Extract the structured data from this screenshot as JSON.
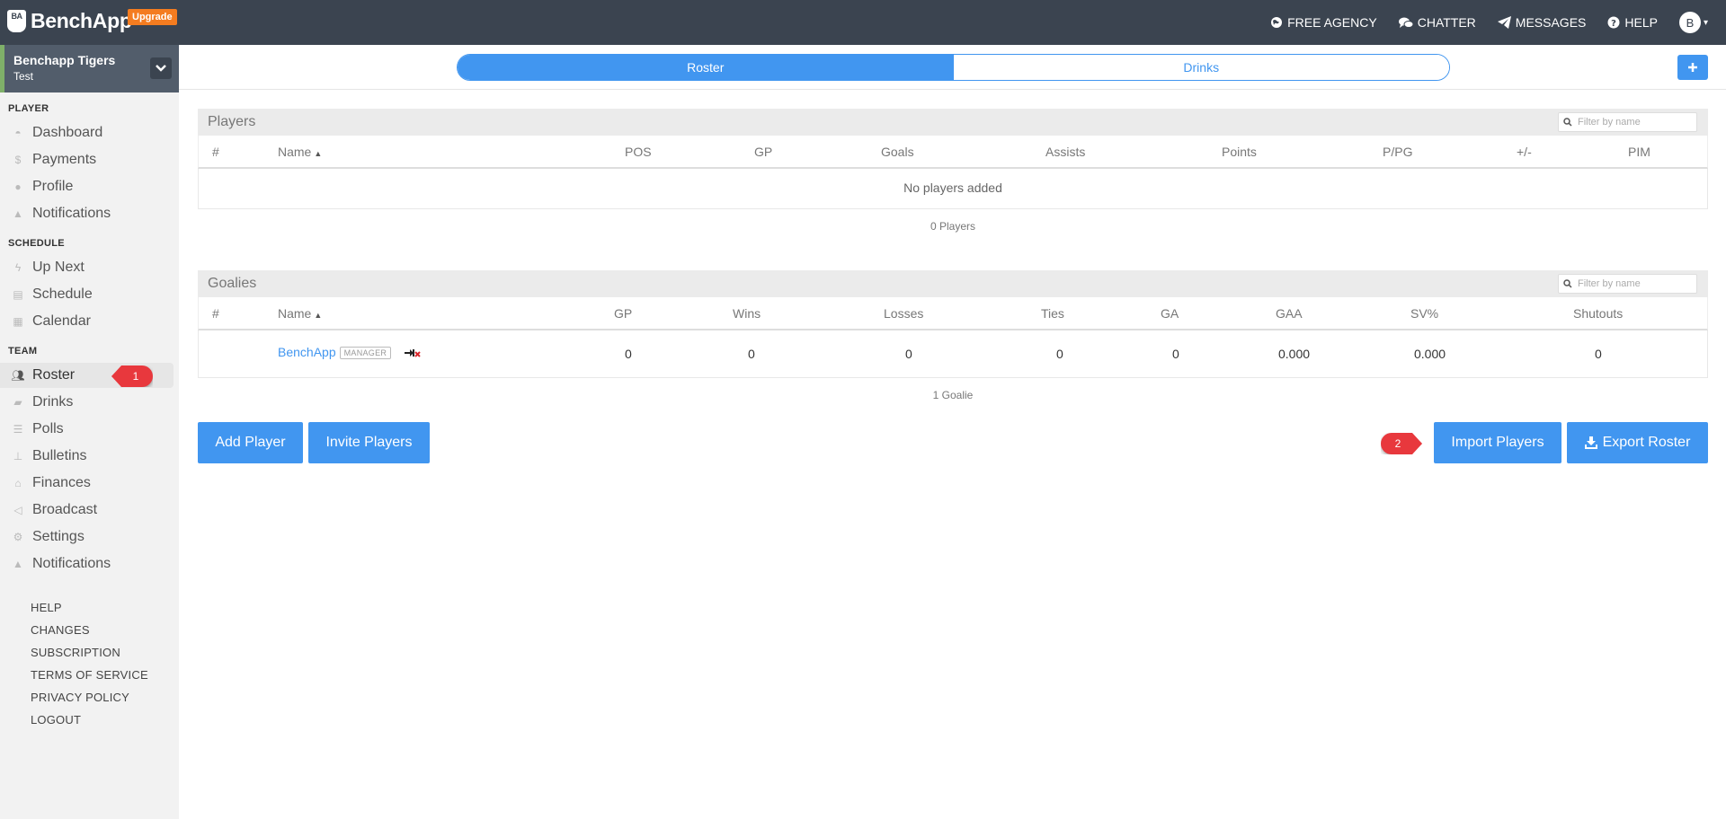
{
  "header": {
    "logo_mark": "BA",
    "logo_text": "BenchApp",
    "upgrade_label": "Upgrade",
    "nav": {
      "free_agency": "FREE AGENCY",
      "chatter": "CHATTER",
      "messages": "MESSAGES",
      "help": "HELP"
    },
    "avatar_initial": "B"
  },
  "sidebar": {
    "team_name": "Benchapp Tigers",
    "team_sub": "Test",
    "sections": {
      "player": "PLAYER",
      "schedule": "SCHEDULE",
      "team": "TEAM"
    },
    "player_items": [
      "Dashboard",
      "Payments",
      "Profile",
      "Notifications"
    ],
    "schedule_items": [
      "Up Next",
      "Schedule",
      "Calendar"
    ],
    "team_items": [
      "Roster",
      "Drinks",
      "Polls",
      "Bulletins",
      "Finances",
      "Broadcast",
      "Settings",
      "Notifications"
    ],
    "footer_links": [
      "HELP",
      "CHANGES",
      "SUBSCRIPTION",
      "TERMS OF SERVICE",
      "PRIVACY POLICY",
      "LOGOUT"
    ]
  },
  "markers": {
    "one": "1",
    "two": "2"
  },
  "tabs": {
    "roster": "Roster",
    "drinks": "Drinks"
  },
  "players": {
    "title": "Players",
    "filter_placeholder": "Filter by name",
    "columns": [
      "#",
      "Name",
      "POS",
      "GP",
      "Goals",
      "Assists",
      "Points",
      "P/PG",
      "+/-",
      "PIM"
    ],
    "empty_message": "No players added",
    "count": "0 Players"
  },
  "goalies": {
    "title": "Goalies",
    "filter_placeholder": "Filter by name",
    "columns": [
      "#",
      "Name",
      "GP",
      "Wins",
      "Losses",
      "Ties",
      "GA",
      "GAA",
      "SV%",
      "Shutouts"
    ],
    "rows": [
      {
        "number": "",
        "name": "BenchApp",
        "badge": "MANAGER",
        "gp": "0",
        "wins": "0",
        "losses": "0",
        "ties": "0",
        "ga": "0",
        "gaa": "0.000",
        "sv": "0.000",
        "shutouts": "0"
      }
    ],
    "count": "1 Goalie"
  },
  "actions": {
    "add_player": "Add Player",
    "invite_players": "Invite Players",
    "import_players": "Import Players",
    "export_roster": "Export Roster"
  },
  "colors": {
    "topbar": "#3b4450",
    "accent": "#4196f0",
    "upgrade": "#f47c20",
    "marker": "#e8383d"
  }
}
